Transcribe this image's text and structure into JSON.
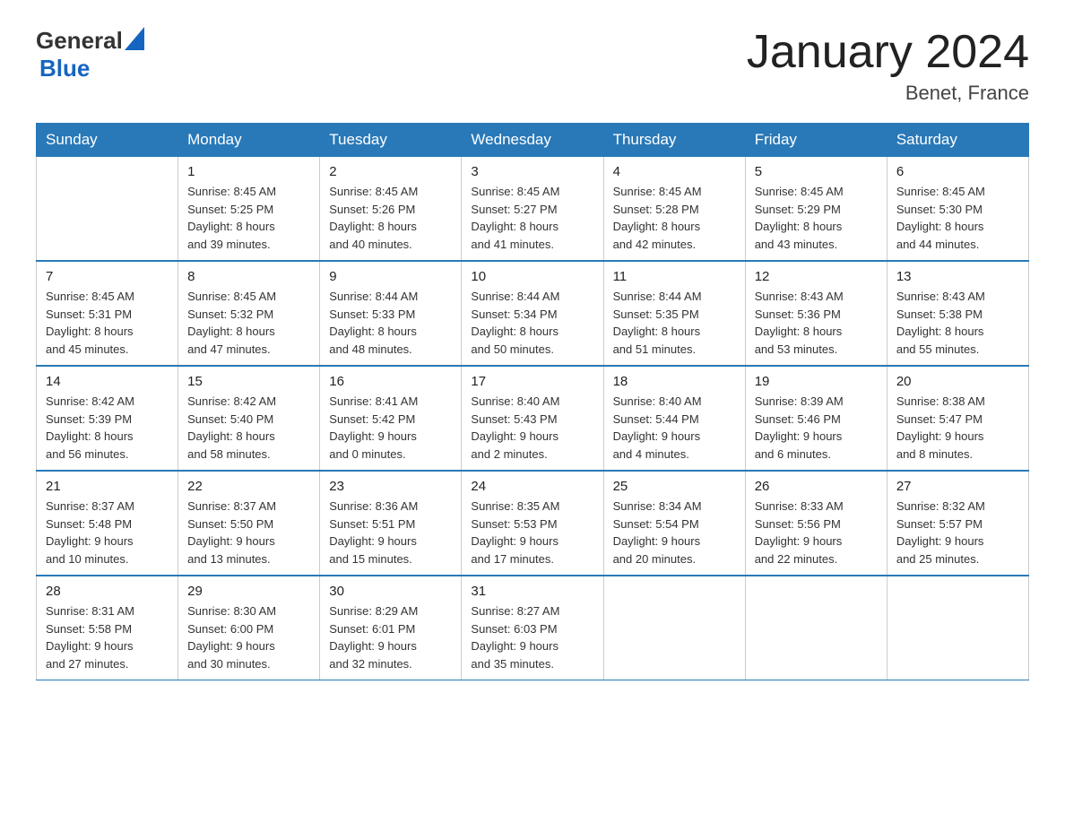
{
  "header": {
    "logo_general": "General",
    "logo_blue": "Blue",
    "month_title": "January 2024",
    "location": "Benet, France"
  },
  "days_of_week": [
    "Sunday",
    "Monday",
    "Tuesday",
    "Wednesday",
    "Thursday",
    "Friday",
    "Saturday"
  ],
  "weeks": [
    [
      {
        "day": "",
        "info": ""
      },
      {
        "day": "1",
        "info": "Sunrise: 8:45 AM\nSunset: 5:25 PM\nDaylight: 8 hours\nand 39 minutes."
      },
      {
        "day": "2",
        "info": "Sunrise: 8:45 AM\nSunset: 5:26 PM\nDaylight: 8 hours\nand 40 minutes."
      },
      {
        "day": "3",
        "info": "Sunrise: 8:45 AM\nSunset: 5:27 PM\nDaylight: 8 hours\nand 41 minutes."
      },
      {
        "day": "4",
        "info": "Sunrise: 8:45 AM\nSunset: 5:28 PM\nDaylight: 8 hours\nand 42 minutes."
      },
      {
        "day": "5",
        "info": "Sunrise: 8:45 AM\nSunset: 5:29 PM\nDaylight: 8 hours\nand 43 minutes."
      },
      {
        "day": "6",
        "info": "Sunrise: 8:45 AM\nSunset: 5:30 PM\nDaylight: 8 hours\nand 44 minutes."
      }
    ],
    [
      {
        "day": "7",
        "info": "Sunrise: 8:45 AM\nSunset: 5:31 PM\nDaylight: 8 hours\nand 45 minutes."
      },
      {
        "day": "8",
        "info": "Sunrise: 8:45 AM\nSunset: 5:32 PM\nDaylight: 8 hours\nand 47 minutes."
      },
      {
        "day": "9",
        "info": "Sunrise: 8:44 AM\nSunset: 5:33 PM\nDaylight: 8 hours\nand 48 minutes."
      },
      {
        "day": "10",
        "info": "Sunrise: 8:44 AM\nSunset: 5:34 PM\nDaylight: 8 hours\nand 50 minutes."
      },
      {
        "day": "11",
        "info": "Sunrise: 8:44 AM\nSunset: 5:35 PM\nDaylight: 8 hours\nand 51 minutes."
      },
      {
        "day": "12",
        "info": "Sunrise: 8:43 AM\nSunset: 5:36 PM\nDaylight: 8 hours\nand 53 minutes."
      },
      {
        "day": "13",
        "info": "Sunrise: 8:43 AM\nSunset: 5:38 PM\nDaylight: 8 hours\nand 55 minutes."
      }
    ],
    [
      {
        "day": "14",
        "info": "Sunrise: 8:42 AM\nSunset: 5:39 PM\nDaylight: 8 hours\nand 56 minutes."
      },
      {
        "day": "15",
        "info": "Sunrise: 8:42 AM\nSunset: 5:40 PM\nDaylight: 8 hours\nand 58 minutes."
      },
      {
        "day": "16",
        "info": "Sunrise: 8:41 AM\nSunset: 5:42 PM\nDaylight: 9 hours\nand 0 minutes."
      },
      {
        "day": "17",
        "info": "Sunrise: 8:40 AM\nSunset: 5:43 PM\nDaylight: 9 hours\nand 2 minutes."
      },
      {
        "day": "18",
        "info": "Sunrise: 8:40 AM\nSunset: 5:44 PM\nDaylight: 9 hours\nand 4 minutes."
      },
      {
        "day": "19",
        "info": "Sunrise: 8:39 AM\nSunset: 5:46 PM\nDaylight: 9 hours\nand 6 minutes."
      },
      {
        "day": "20",
        "info": "Sunrise: 8:38 AM\nSunset: 5:47 PM\nDaylight: 9 hours\nand 8 minutes."
      }
    ],
    [
      {
        "day": "21",
        "info": "Sunrise: 8:37 AM\nSunset: 5:48 PM\nDaylight: 9 hours\nand 10 minutes."
      },
      {
        "day": "22",
        "info": "Sunrise: 8:37 AM\nSunset: 5:50 PM\nDaylight: 9 hours\nand 13 minutes."
      },
      {
        "day": "23",
        "info": "Sunrise: 8:36 AM\nSunset: 5:51 PM\nDaylight: 9 hours\nand 15 minutes."
      },
      {
        "day": "24",
        "info": "Sunrise: 8:35 AM\nSunset: 5:53 PM\nDaylight: 9 hours\nand 17 minutes."
      },
      {
        "day": "25",
        "info": "Sunrise: 8:34 AM\nSunset: 5:54 PM\nDaylight: 9 hours\nand 20 minutes."
      },
      {
        "day": "26",
        "info": "Sunrise: 8:33 AM\nSunset: 5:56 PM\nDaylight: 9 hours\nand 22 minutes."
      },
      {
        "day": "27",
        "info": "Sunrise: 8:32 AM\nSunset: 5:57 PM\nDaylight: 9 hours\nand 25 minutes."
      }
    ],
    [
      {
        "day": "28",
        "info": "Sunrise: 8:31 AM\nSunset: 5:58 PM\nDaylight: 9 hours\nand 27 minutes."
      },
      {
        "day": "29",
        "info": "Sunrise: 8:30 AM\nSunset: 6:00 PM\nDaylight: 9 hours\nand 30 minutes."
      },
      {
        "day": "30",
        "info": "Sunrise: 8:29 AM\nSunset: 6:01 PM\nDaylight: 9 hours\nand 32 minutes."
      },
      {
        "day": "31",
        "info": "Sunrise: 8:27 AM\nSunset: 6:03 PM\nDaylight: 9 hours\nand 35 minutes."
      },
      {
        "day": "",
        "info": ""
      },
      {
        "day": "",
        "info": ""
      },
      {
        "day": "",
        "info": ""
      }
    ]
  ]
}
